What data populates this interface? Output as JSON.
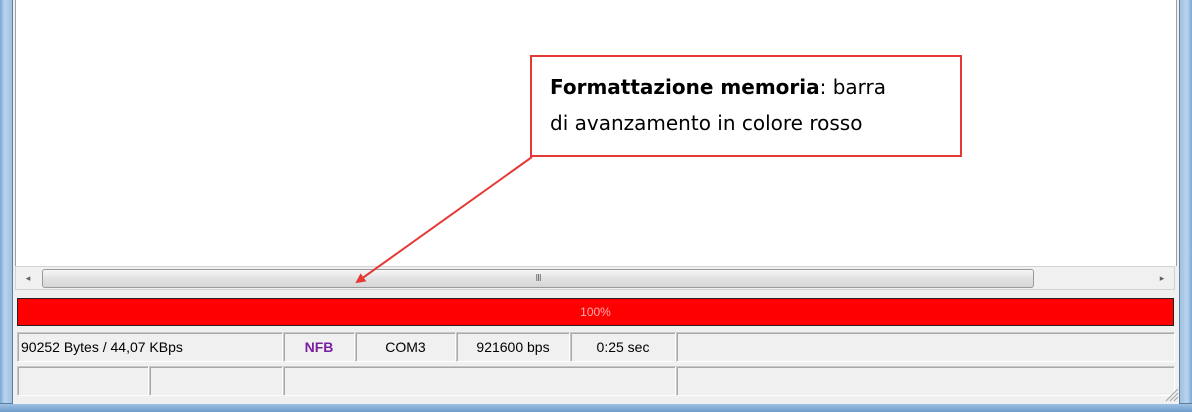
{
  "scrollbar": {
    "left_arrow": "◂",
    "right_arrow": "▸",
    "grip": "III"
  },
  "progress": {
    "label": "100%",
    "fraction": 1.0,
    "color": "#ff0000"
  },
  "status_row1": {
    "transfer": "90252 Bytes / 44,07 KBps",
    "mode": "NFB",
    "port": "COM3",
    "baud": "921600 bps",
    "time": "0:25 sec",
    "extra": ""
  },
  "status_row2": {
    "cells": [
      "",
      "",
      "",
      "",
      ""
    ]
  },
  "annotation": {
    "title": "Formattazione memoria",
    "text_after_title": ": barra",
    "text_line2": "di avanzamento in colore rosso",
    "color": "#e53935"
  }
}
